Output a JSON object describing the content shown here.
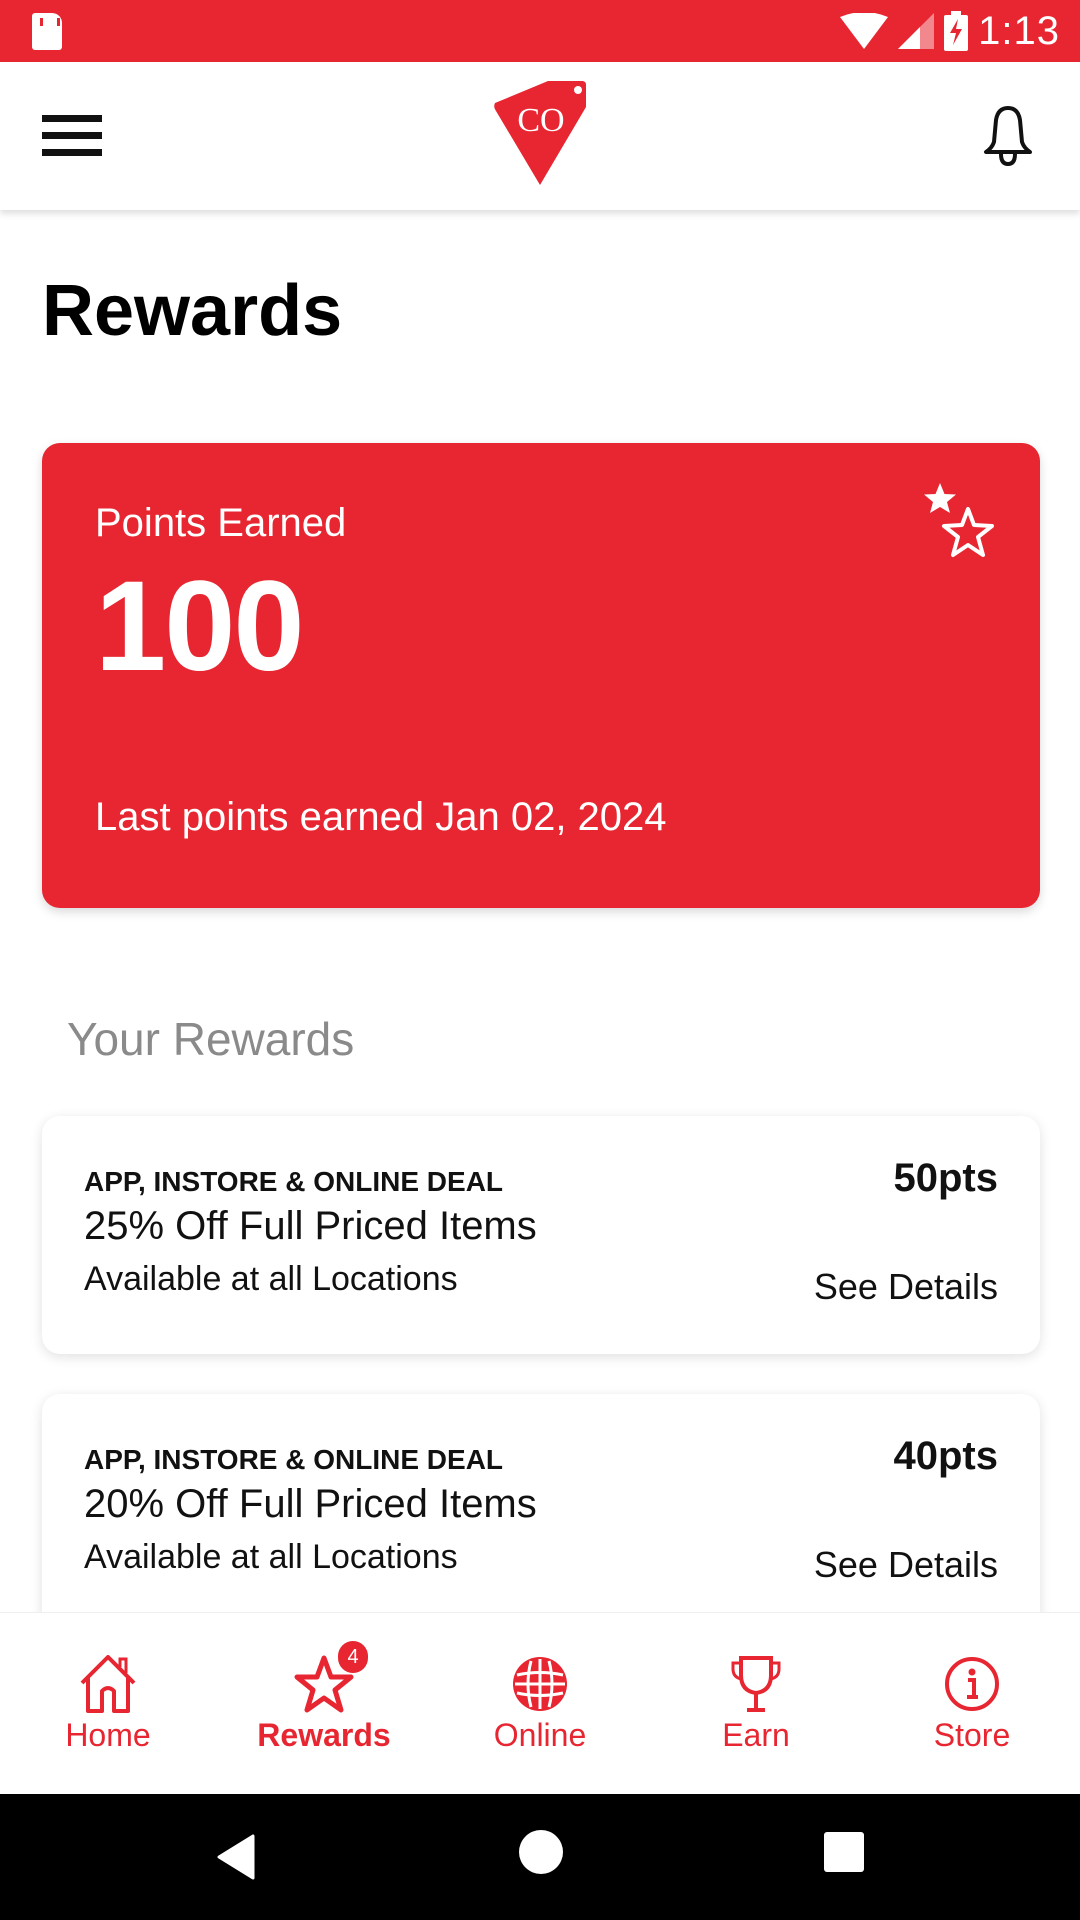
{
  "status_bar": {
    "time": "1:13"
  },
  "header": {
    "logo_text": "CO"
  },
  "page": {
    "title": "Rewards"
  },
  "points_card": {
    "label": "Points Earned",
    "value": "100",
    "last_earned": "Last points earned Jan 02, 2024"
  },
  "rewards_section": {
    "title": "Your Rewards",
    "items": [
      {
        "type": "APP, INSTORE & ONLINE DEAL",
        "title": "25% Off Full Priced Items",
        "subtitle": "Available at all Locations",
        "points": "50pts",
        "details_label": "See Details"
      },
      {
        "type": "APP, INSTORE & ONLINE DEAL",
        "title": "20% Off Full Priced Items",
        "subtitle": "Available at all Locations",
        "points": "40pts",
        "details_label": "See Details"
      }
    ]
  },
  "bottom_nav": {
    "items": [
      {
        "label": "Home",
        "icon": "home-icon"
      },
      {
        "label": "Rewards",
        "icon": "star-icon",
        "badge": "4",
        "active": true
      },
      {
        "label": "Online",
        "icon": "globe-icon"
      },
      {
        "label": "Earn",
        "icon": "trophy-icon"
      },
      {
        "label": "Store",
        "icon": "info-icon"
      }
    ]
  },
  "colors": {
    "brand": "#e72631",
    "text": "#111111",
    "muted": "#8a8a8a"
  }
}
